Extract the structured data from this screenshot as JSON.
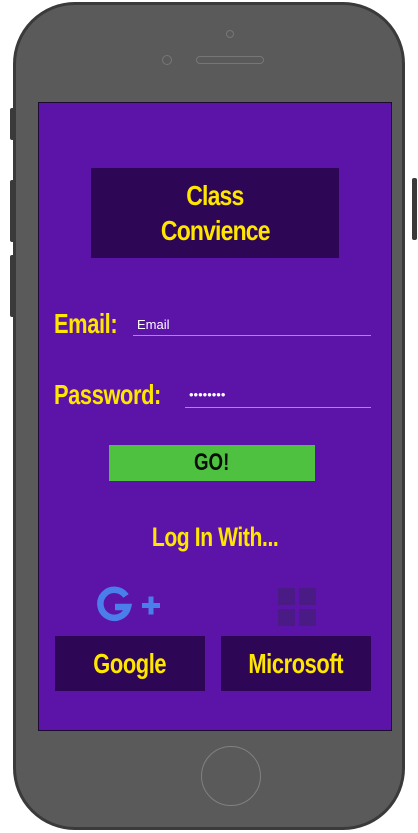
{
  "app": {
    "title_line1": "Class",
    "title_line2": "Convience"
  },
  "form": {
    "email_label": "Email:",
    "email_placeholder": "Email",
    "password_label": "Password:",
    "password_value": "••••••••",
    "go_label": "GO!"
  },
  "social": {
    "heading": "Log In With...",
    "google_label": "Google",
    "microsoft_label": "Microsoft",
    "google_icon": "google-plus-icon",
    "microsoft_icon": "microsoft-grid-icon"
  },
  "colors": {
    "screen_bg": "#5b13a8",
    "panel_bg": "#2d0755",
    "accent_text": "#ffe600",
    "go_button": "#4ec240",
    "google_blue": "#4a7eea"
  }
}
